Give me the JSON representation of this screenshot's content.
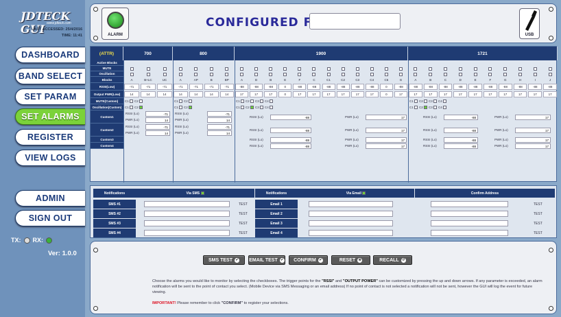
{
  "brand": {
    "logo": "JDTECK",
    "logo_suffix": "GUI",
    "url": "www.jdteck.com",
    "last_accessed_label": "LAST ACCESSED:",
    "last_accessed": "25/4/2016",
    "time_label": "TIME:",
    "time": "11:41"
  },
  "nav": [
    "DASHBOARD",
    "BAND SELECT",
    "SET PARAM",
    "SET ALARMS",
    "REGISTER",
    "VIEW LOGS",
    "ADMIN",
    "SIGN OUT"
  ],
  "status": {
    "tx": "TX:",
    "rx": "RX:",
    "version": "Ver: 1.0.0"
  },
  "top": {
    "alarm_label": "ALARM",
    "configured_for": "CONFIGURED FOR:",
    "configured_value": "",
    "usb_label": "USB"
  },
  "grid": {
    "attr_label": "(ATTR)",
    "bands": [
      "700",
      "800",
      "1900",
      "1721"
    ],
    "row_labels": [
      "Active Blocks",
      "MUTE",
      "Oscillation",
      "Blocks",
      "RSSI(Low)",
      "Output PWR(Low)",
      "MUTE(Custom)",
      "Oscillation(Custom)",
      "Custom1",
      "Custom2",
      "Custom3",
      "Custom4"
    ],
    "blocks_700": [
      "A",
      "B+LC",
      "UC"
    ],
    "blocks_800": [
      "A",
      "AP",
      "B",
      "BP"
    ],
    "blocks_1900": [
      "A",
      "D",
      "B",
      "E",
      "F",
      "C",
      "C1",
      "C2",
      "C3",
      "C4",
      "C5",
      "G"
    ],
    "blocks_1721": [
      "A",
      "B",
      "C",
      "D",
      "E",
      "F",
      "G",
      "H",
      "I",
      "J"
    ],
    "rssi_700": [
      "-71",
      "-71",
      "-71"
    ],
    "rssi_800": [
      "-71",
      "-71",
      "-71",
      "-71"
    ],
    "rssi_1900": [
      "-88",
      "-88",
      "-88",
      "0",
      "-88",
      "-88",
      "-88",
      "-88",
      "-88",
      "-88",
      "0",
      "-88"
    ],
    "rssi_1721": [
      "-88",
      "-88",
      "-88",
      "-88",
      "-88",
      "-88",
      "-88",
      "-88",
      "-88",
      "-88"
    ],
    "pwr_700": [
      "14",
      "14",
      "14"
    ],
    "pwr_800": [
      "14",
      "14",
      "14",
      "14"
    ],
    "pwr_1900": [
      "17",
      "17",
      "17",
      "0",
      "17",
      "17",
      "17",
      "17",
      "17",
      "17",
      "0",
      "17"
    ],
    "pwr_1721": [
      "17",
      "17",
      "17",
      "17",
      "17",
      "17",
      "17",
      "17",
      "17",
      "17"
    ],
    "custom_labels": [
      "C1",
      "C2",
      "C3",
      "C4"
    ],
    "rssi_lo_label": "RSSI (Lo)",
    "pwr_lo_label": "PWR (Lo)",
    "c_small_rssi": "-71",
    "c_small_pwr": "14",
    "c_large_rssi": "-88",
    "c_large_pwr": "17"
  },
  "notifications": {
    "header_notifications": "Notifications",
    "via_sms": "Via SMS",
    "via_email": "Via Email",
    "confirm_address": "Confirm Address",
    "sms_rows": [
      "SMS #1",
      "SMS #2",
      "SMS #3",
      "SMS #4"
    ],
    "email_rows": [
      "Email 1",
      "Email 2",
      "Email 3",
      "Email 4"
    ],
    "test": "TEST"
  },
  "actions": {
    "sms_test": "SMS TEST",
    "email_test": "EMAIL TEST",
    "confirm": "CONFIRM",
    "reset": "RESET",
    "recall": "RECALL",
    "description_1": "Choose the alarms you would like to monitor by selecting the checkboxes. The trigger points for the ",
    "rssi_bold": "\"RSSI\"",
    "description_and": " and ",
    "output_bold": "\"OUTPUT POWER\"",
    "description_2": " can be customized by pressing the up and down arrows. If any parameter is exceeded, an alarm notification will be sent to the point of contact you select. (Mobile Device via SMS Messaging or an email address) If no point of contact is not selected a notification will not be sent, however the GUI will log the event for future viewing.",
    "important": "IMPORTANT!",
    "important_text_1": " Please remember to click ",
    "confirm_quoted": "\"CONFIRM\"",
    "important_text_2": " to register your selections."
  },
  "colors": {
    "accent": "#1f3b73",
    "active_nav": "#7bd23a",
    "title": "#2a2a9a",
    "important": "#d12"
  }
}
